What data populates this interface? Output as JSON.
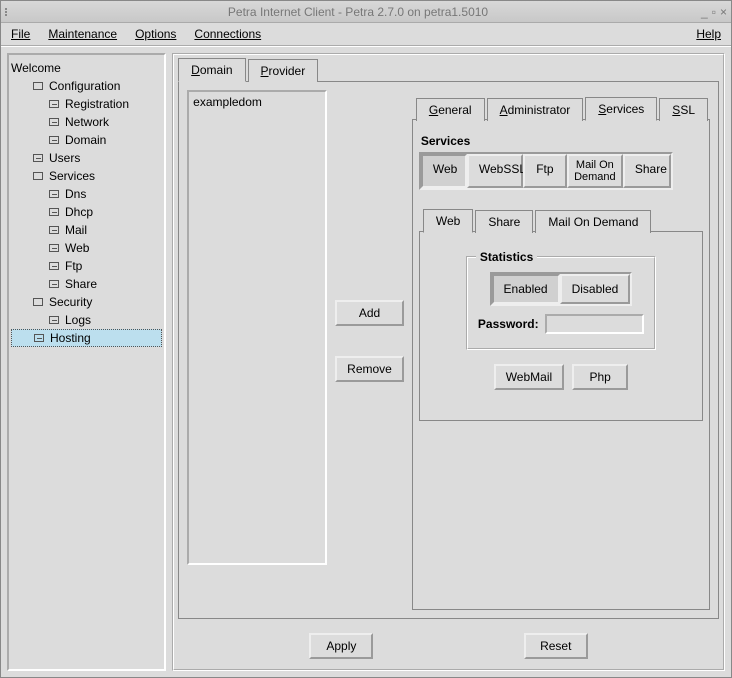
{
  "window": {
    "title": "Petra Internet Client - Petra 2.7.0 on petra1.5010"
  },
  "menu": {
    "file": "File",
    "maintenance": "Maintenance",
    "options": "Options",
    "connections": "Connections",
    "help": "Help"
  },
  "tree": {
    "root": "Welcome",
    "items": [
      {
        "label": "Configuration",
        "depth": 1,
        "icon": "folder"
      },
      {
        "label": "Registration",
        "depth": 2,
        "icon": "box"
      },
      {
        "label": "Network",
        "depth": 2,
        "icon": "box"
      },
      {
        "label": "Domain",
        "depth": 2,
        "icon": "box"
      },
      {
        "label": "Users",
        "depth": 1,
        "icon": "box"
      },
      {
        "label": "Services",
        "depth": 1,
        "icon": "folder"
      },
      {
        "label": "Dns",
        "depth": 2,
        "icon": "box"
      },
      {
        "label": "Dhcp",
        "depth": 2,
        "icon": "box"
      },
      {
        "label": "Mail",
        "depth": 2,
        "icon": "box"
      },
      {
        "label": "Web",
        "depth": 2,
        "icon": "box"
      },
      {
        "label": "Ftp",
        "depth": 2,
        "icon": "box"
      },
      {
        "label": "Share",
        "depth": 2,
        "icon": "box"
      },
      {
        "label": "Security",
        "depth": 1,
        "icon": "folder"
      },
      {
        "label": "Logs",
        "depth": 2,
        "icon": "box"
      },
      {
        "label": "Hosting",
        "depth": 1,
        "icon": "box",
        "selected": true
      }
    ]
  },
  "main": {
    "tabs": {
      "domain": "Domain",
      "provider": "Provider"
    },
    "list": {
      "item0": "exampledom"
    },
    "buttons": {
      "add": "Add",
      "remove": "Remove",
      "apply": "Apply",
      "reset": "Reset"
    },
    "subtabs": {
      "general": "General",
      "administrator": "Administrator",
      "services": "Services",
      "ssl": "SSL"
    },
    "services": {
      "label": "Services",
      "web": "Web",
      "webssl": "WebSSL",
      "ftp": "Ftp",
      "mod": "Mail On\nDemand",
      "share": "Share"
    },
    "subtabs2": {
      "web": "Web",
      "share": "Share",
      "mod": "Mail On Demand"
    },
    "stats": {
      "legend": "Statistics",
      "enabled": "Enabled",
      "disabled": "Disabled",
      "password_label": "Password:"
    },
    "webmail": "WebMail",
    "php": "Php"
  }
}
